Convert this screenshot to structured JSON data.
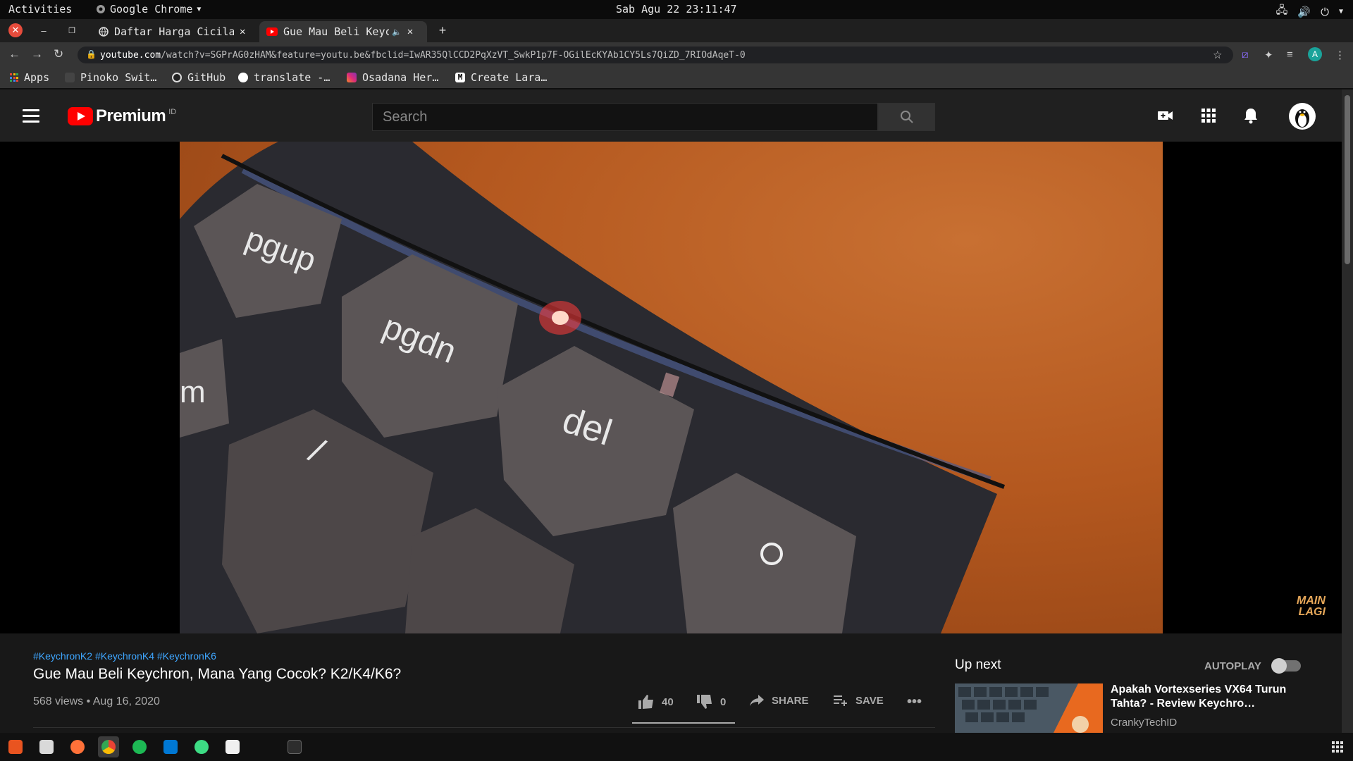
{
  "system": {
    "activities": "Activities",
    "app_name": "Google Chrome",
    "clock": "Sab Agu 22 23:11:47"
  },
  "tabs": [
    {
      "title": "Daftar Harga Cicilan",
      "active": false
    },
    {
      "title": "Gue Mau Beli Keychron",
      "active": true
    }
  ],
  "address_bar": {
    "host": "youtube.com",
    "path": "/watch?v=SGPrAG0zHAM&feature=youtu.be&fbclid=IwAR35QlCCD2PqXzVT_SwkP1p7F-OGilEcKYAb1CY5Ls7QiZD_7RIOdAqeT-0",
    "profile_initial": "A"
  },
  "bookmarks": [
    {
      "label": "Apps",
      "icon": "apps-grid-icon"
    },
    {
      "label": "Pinoko Swit…",
      "icon": "bookmark-favicon"
    },
    {
      "label": "GitHub",
      "icon": "github-icon"
    },
    {
      "label": "translate -…",
      "icon": "google-icon"
    },
    {
      "label": "Osadana Her…",
      "icon": "instagram-icon"
    },
    {
      "label": "Create Lara…",
      "icon": "medium-icon"
    }
  ],
  "youtube": {
    "brand": "Premium",
    "country_code": "ID",
    "search_placeholder": "Search"
  },
  "video": {
    "hashtags": "#KeychronK2 #KeychronK4 #KeychronK6",
    "title": "Gue Mau Beli Keychron, Mana Yang Cocok? K2/K4/K6?",
    "views_date": "568 views • Aug 16, 2020",
    "likes": "40",
    "dislikes": "0",
    "share_label": "SHARE",
    "save_label": "SAVE",
    "watermark_line1": "MAIN",
    "watermark_line2": "LAGI",
    "key_labels": [
      "pgup",
      "pgdn",
      "del",
      "m",
      "/"
    ]
  },
  "upnext": {
    "heading": "Up next",
    "autoplay_label": "AUTOPLAY",
    "autoplay_on": false,
    "item_title": "Apakah Vortexseries VX64 Turun Tahta? - Review Keychro…",
    "item_channel": "CrankyTechID"
  },
  "colors": {
    "yt_red": "#ff0000",
    "link_blue": "#3ea6ff",
    "bg_dark": "#181818"
  }
}
